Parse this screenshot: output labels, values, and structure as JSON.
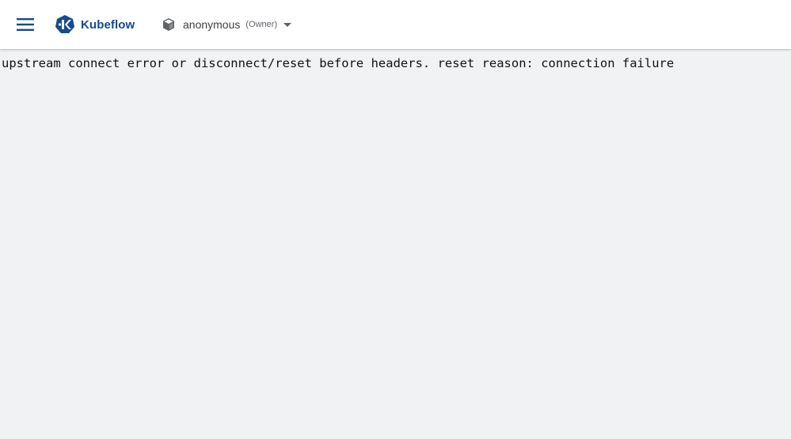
{
  "header": {
    "app_name": "Kubeflow",
    "namespace": {
      "name": "anonymous",
      "role": "(Owner)"
    }
  },
  "icons": {
    "menu": "hamburger-menu-icon",
    "logo": "kubeflow-logo-icon",
    "namespace": "cube-icon",
    "dropdown": "arrow-drop-down-icon"
  },
  "colors": {
    "brand": "#194a8a",
    "menu_icon": "#1a4a86",
    "background": "#f1f2f4"
  },
  "main": {
    "error_message": "upstream connect error or disconnect/reset before headers. reset reason: connection failure"
  }
}
